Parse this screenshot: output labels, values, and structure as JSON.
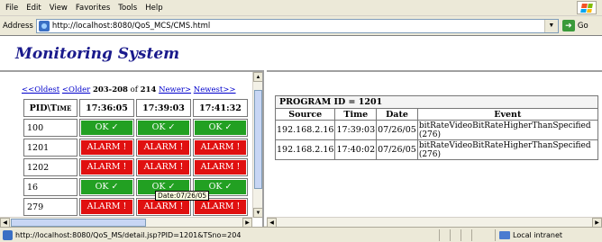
{
  "menu": [
    "File",
    "Edit",
    "View",
    "Favorites",
    "Tools",
    "Help"
  ],
  "address": {
    "label": "Address",
    "url": "http://localhost:8080/QoS_MCS/CMS.html",
    "go_label": "Go"
  },
  "header": {
    "title": "Monitoring System"
  },
  "nav": {
    "oldest": "<<Oldest",
    "older": "<Older",
    "range": "203-208",
    "of_text": "of",
    "total": "214",
    "newer": "Newer>",
    "newest": "Newest>>"
  },
  "grid": {
    "corner": "PID\\Time",
    "times": [
      "17:36:05",
      "17:39:03",
      "17:41:32"
    ],
    "rows": [
      {
        "pid": "100",
        "cells": [
          "OK ✓",
          "OK ✓",
          "OK ✓"
        ],
        "states": [
          "ok",
          "ok",
          "ok"
        ]
      },
      {
        "pid": "1201",
        "cells": [
          "ALARM !",
          "ALARM !",
          "ALARM !"
        ],
        "states": [
          "alarm",
          "alarm",
          "alarm"
        ]
      },
      {
        "pid": "1202",
        "cells": [
          "ALARM !",
          "ALARM !",
          "ALARM !"
        ],
        "states": [
          "alarm",
          "alarm",
          "alarm"
        ]
      },
      {
        "pid": "16",
        "cells": [
          "OK ✓",
          "OK ✓",
          "OK ✓"
        ],
        "states": [
          "ok",
          "ok",
          "ok"
        ]
      },
      {
        "pid": "279",
        "cells": [
          "ALARM !",
          "ALARM !",
          "ALARM !"
        ],
        "states": [
          "alarm",
          "alarm",
          "alarm"
        ]
      }
    ],
    "tooltip": "Date:07/26/05"
  },
  "program": {
    "title": "PROGRAM ID = 1201",
    "columns": [
      "Source",
      "Time",
      "Date",
      "Event"
    ],
    "rows": [
      {
        "source": "192.168.2.16",
        "time": "17:39:03",
        "date": "07/26/05",
        "event": "bitRateVideoBitRateHigherThanSpecified (276)"
      },
      {
        "source": "192.168.2.16",
        "time": "17:40:02",
        "date": "07/26/05",
        "event": "bitRateVideoBitRateHigherThanSpecified (276)"
      }
    ]
  },
  "statusbar": {
    "text": "http://localhost:8080/QoS_MS/detail.jsp?PID=1201&TSno=204",
    "zone": "Local intranet"
  },
  "colors": {
    "ok": "#22a022",
    "alarm": "#e01010",
    "title": "#1a1a8c",
    "link": "#0000cc"
  }
}
